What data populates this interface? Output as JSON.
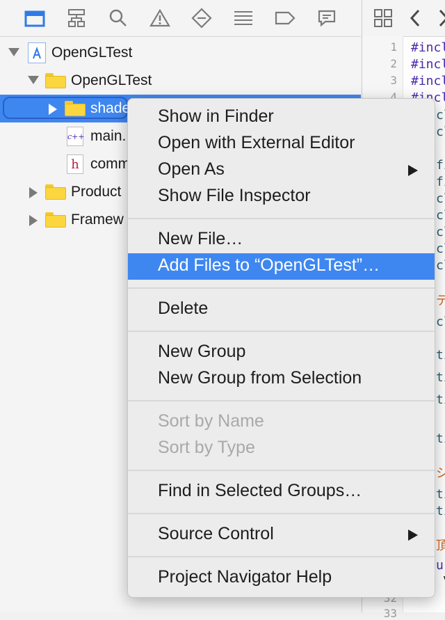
{
  "navigator": {
    "toolbar_icons": [
      "folder-icon",
      "hierarchy-icon",
      "search-icon",
      "warning-icon",
      "diamond-icon",
      "list-icon",
      "tag-icon",
      "chat-icon"
    ],
    "tree": [
      {
        "label": "OpenGLTest",
        "kind": "project"
      },
      {
        "label": "OpenGLTest",
        "kind": "folder"
      },
      {
        "label": "shade",
        "kind": "folder"
      },
      {
        "label": "main.",
        "kind": "cpp-file",
        "badge": "c++"
      },
      {
        "label": "comm",
        "kind": "header-file",
        "badge": "h"
      },
      {
        "label": "Product",
        "kind": "folder"
      },
      {
        "label": "Framew",
        "kind": "folder"
      }
    ]
  },
  "editor": {
    "line_numbers": [
      "1",
      "2",
      "3",
      "4",
      "32",
      "33"
    ],
    "code_fragments": [
      "#incl",
      "#incl",
      "#incl",
      "#incl",
      "cl",
      "cl",
      "fi",
      "fi",
      "cl",
      "cl",
      "cl",
      "cl",
      "cl",
      "テ",
      "cl",
      "ti",
      "ti",
      "ti",
      "ti",
      "シ",
      "ti",
      "ti",
      "頂",
      "u",
      "v"
    ]
  },
  "context_menu": {
    "groups": [
      [
        {
          "label": "Show in Finder"
        },
        {
          "label": "Open with External Editor"
        },
        {
          "label": "Open As",
          "submenu": true
        },
        {
          "label": "Show File Inspector"
        }
      ],
      [
        {
          "label": "New File…"
        },
        {
          "label": "Add Files to “OpenGLTest”…",
          "highlighted": true
        }
      ],
      [
        {
          "label": "Delete"
        }
      ],
      [
        {
          "label": "New Group"
        },
        {
          "label": "New Group from Selection"
        }
      ],
      [
        {
          "label": "Sort by Name",
          "disabled": true
        },
        {
          "label": "Sort by Type",
          "disabled": true
        }
      ],
      [
        {
          "label": "Find in Selected Groups…"
        }
      ],
      [
        {
          "label": "Source Control",
          "submenu": true
        }
      ],
      [
        {
          "label": "Project Navigator Help"
        }
      ]
    ]
  },
  "colors": {
    "selection": "#3f87f0",
    "accent_blue": "#2f7ae5",
    "folder_yellow": "#fbd63f",
    "keyword_purple": "#4b2aa8",
    "comment_orange": "#d4651a"
  }
}
